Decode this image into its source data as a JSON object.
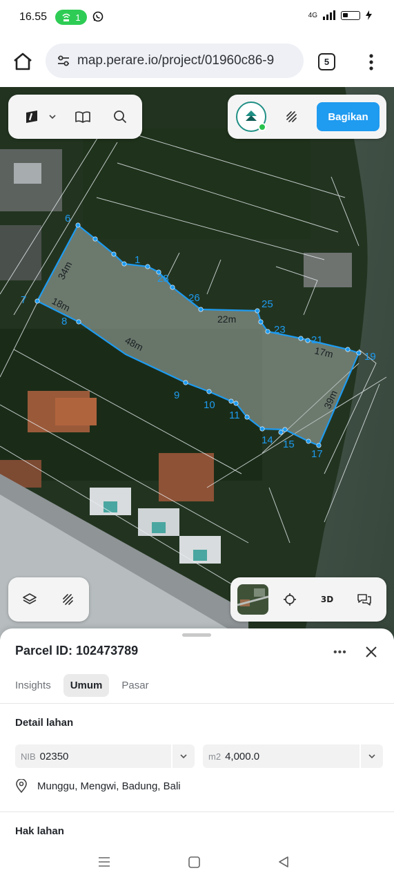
{
  "status_bar": {
    "time": "16.55",
    "hotspot_count": "1",
    "network": "4G",
    "icons": [
      "hotspot-icon",
      "whatsapp-icon",
      "signal-icon",
      "battery-icon",
      "charging-icon"
    ]
  },
  "browser": {
    "url": "map.perare.io/project/01960c86-9",
    "tab_count": "5"
  },
  "map_toolbar": {
    "share_label": "Bagikan",
    "view_3d_label": "3D"
  },
  "map": {
    "parcel_color": "#1e9bf0",
    "vertex_labels": [
      "1",
      "6",
      "7",
      "8",
      "9",
      "10",
      "11",
      "14",
      "15",
      "17",
      "19",
      "21",
      "23",
      "25",
      "26",
      "28"
    ],
    "edge_labels": [
      "34m",
      "18m",
      "48m",
      "22m",
      "17m",
      "39m"
    ]
  },
  "sheet": {
    "parcel_title": "Parcel ID: 102473789",
    "tabs": [
      "Insights",
      "Umum",
      "Pasar"
    ],
    "active_tab": "Umum",
    "detail_heading": "Detail lahan",
    "nib_prefix": "NIB",
    "nib_value": "02350",
    "area_prefix": "m2",
    "area_value": "4,000.0",
    "location": "Munggu, Mengwi, Badung, Bali",
    "rights_heading": "Hak lahan"
  }
}
